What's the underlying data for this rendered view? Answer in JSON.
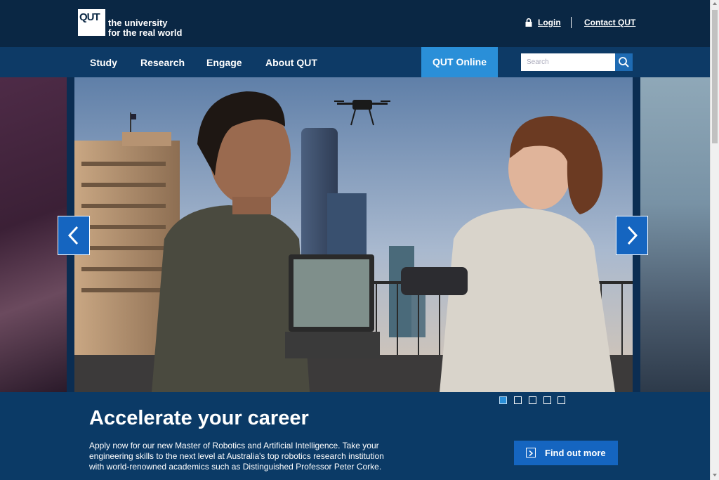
{
  "header": {
    "logo_text": "QUT",
    "tagline_line1": "the university",
    "tagline_line2": "for the real world",
    "login_label": "Login",
    "contact_label": "Contact QUT"
  },
  "nav": {
    "items": [
      {
        "label": "Study"
      },
      {
        "label": "Research"
      },
      {
        "label": "Engage"
      },
      {
        "label": "About QUT"
      }
    ],
    "online_label": "QUT Online",
    "search_placeholder": "Search"
  },
  "hero": {
    "title": "Accelerate your career",
    "description": "Apply now for our new Master of Robotics and Artificial Intelligence. Take your engineering skills to the next level at Australia's top robotics research institution with world-renowned academics such as Distinguished Professor Peter Corke.",
    "cta_label": "Find out more",
    "slide_count": 5,
    "active_slide": 1
  },
  "colors": {
    "header_bg": "#0a2744",
    "nav_bg": "#0d3a66",
    "body_bg": "#0b3a66",
    "accent": "#2a8fd8",
    "button_blue": "#1565c0"
  },
  "icons": [
    "lock-icon",
    "search-icon",
    "chevron-left-icon",
    "chevron-right-icon",
    "arrow-box-icon"
  ]
}
